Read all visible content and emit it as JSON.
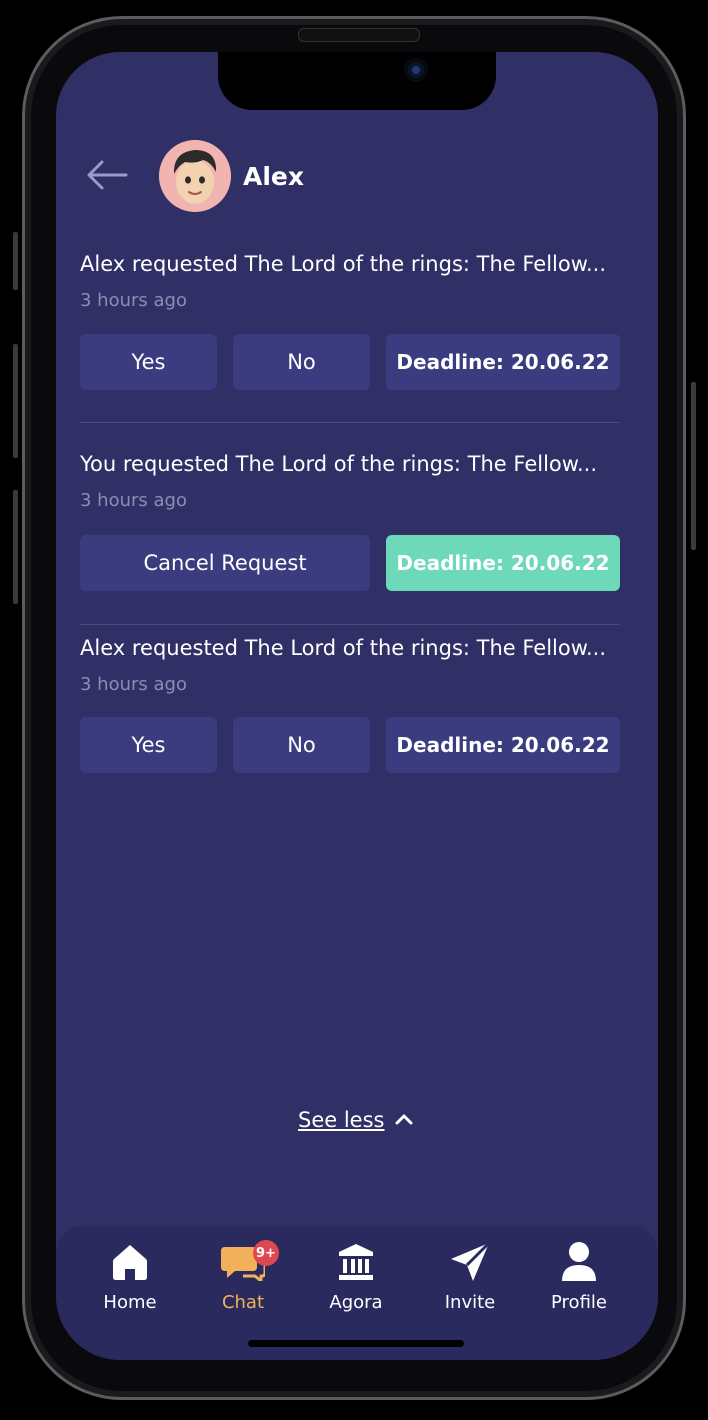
{
  "header": {
    "contact_name": "Alex"
  },
  "requests": [
    {
      "text": "Alex requested The Lord of the rings: The Fellow...",
      "time": "3 hours ago",
      "yes_label": "Yes",
      "no_label": "No",
      "deadline_label": "Deadline: 20.06.22"
    },
    {
      "text": "You requested The Lord of the rings: The Fellow...",
      "time": "3 hours ago",
      "cancel_label": "Cancel Request",
      "deadline_label": "Deadline: 20.06.22"
    },
    {
      "text": "Alex requested The Lord of the rings: The Fellow...",
      "time": "3 hours ago",
      "yes_label": "Yes",
      "no_label": "No",
      "deadline_label": "Deadline: 20.06.22"
    }
  ],
  "see_less": {
    "label": "See less"
  },
  "nav": {
    "items": [
      {
        "label": "Home",
        "icon": "home-icon"
      },
      {
        "label": "Chat",
        "icon": "chat-icon",
        "badge": "9+",
        "active": true
      },
      {
        "label": "Agora",
        "icon": "bank-icon"
      },
      {
        "label": "Invite",
        "icon": "send-icon"
      },
      {
        "label": "Profile",
        "icon": "user-icon"
      }
    ]
  },
  "colors": {
    "background": "#303066",
    "button": "#3b3b80",
    "accent_green": "#6dd9b8",
    "active_nav": "#f2b05a",
    "badge": "#e0484f"
  }
}
